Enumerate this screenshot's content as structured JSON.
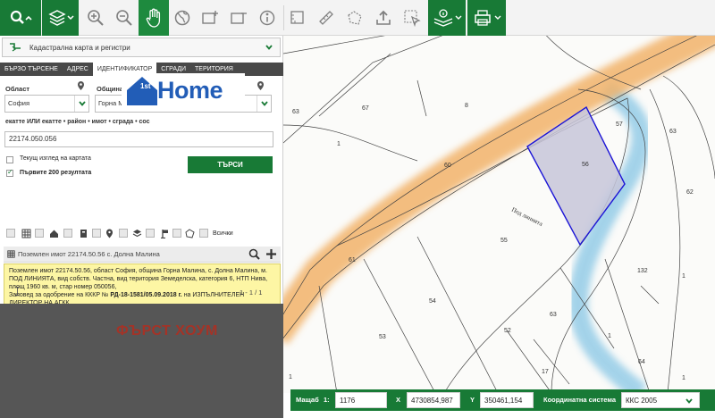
{
  "toolbar": {
    "tools": [
      {
        "icon": "search-icon"
      },
      {
        "icon": "layers-icon"
      },
      {
        "icon": "zoom-in-icon"
      },
      {
        "icon": "zoom-out-icon"
      },
      {
        "icon": "hand-pan-icon"
      },
      {
        "icon": "globe-icon"
      },
      {
        "icon": "add-region-icon"
      },
      {
        "icon": "remove-region-icon"
      },
      {
        "icon": "info-icon"
      },
      {
        "icon": "measure-area-icon"
      },
      {
        "icon": "measure-ruler-icon"
      },
      {
        "icon": "polygon-icon"
      },
      {
        "icon": "upload-icon"
      },
      {
        "icon": "select-region-icon"
      },
      {
        "icon": "layers-settings-icon"
      },
      {
        "icon": "print-icon"
      }
    ]
  },
  "panel": {
    "layer_select": "Кадастрална карта и регистри",
    "tabs": [
      "БЪРЗО ТЪРСЕНЕ",
      "АДРЕС",
      "ИДЕНТИФИКАТОР",
      "СГРАДИ",
      "ТЕРИТОРИЯ"
    ],
    "active_tab": 2,
    "oblast_label": "Област",
    "oblast_value": "София",
    "obshtina_label": "Община",
    "obshtina_value": "Горна Малина",
    "query_label": "екатте ИЛИ екатте • район • имот • сграда • сос",
    "query_value": "22174.050.056",
    "chk_current_view": "Текущ изглед на картата",
    "chk_first_200": "Първите 200 резултата",
    "search_button": "ТЪРСИ",
    "all_label": "Всички",
    "result_title": "Поземлен имот 22174.50.56 с. Долна Малина",
    "info_text": "Поземлен имот 22174.50.56, област София, община Горна Малина, с. Долна Малина, м. ПОД ЛИНИЯТА, вид собств. Частна, вид територия Земеделска, категория 6, НТП Нива, площ 1960 кв. м, стар номер 050056,",
    "info_text2_a": "Заповед за одобрение на КККР №",
    "info_text2_b": "РД-18-1581/05.09.2018 г.",
    "info_text2_c": "на ИЗПЪЛНИТЕЛЕН ДИРЕКТОР НА АГКК",
    "pager": "1 - 1 / 1",
    "watermark": "ФЪРСТ ХОУМ",
    "logo_text": "Home",
    "logo_prefix": "1st"
  },
  "map": {
    "street_label": "Под линията",
    "plot_numbers": [
      "63",
      "67",
      "8",
      "1",
      "57",
      "63",
      "56",
      "60",
      "62",
      "55",
      "61",
      "54",
      "53",
      "52",
      "63",
      "132",
      "1",
      "64",
      "17",
      "1",
      "1",
      "1"
    ],
    "highlight_color": "#1b14d6"
  },
  "status": {
    "scale_label": "Мащаб",
    "scale_prefix": "1:",
    "scale_value": "1176",
    "x_label": "X",
    "x_value": "4730854,987",
    "y_label": "Y",
    "y_value": "350461,154",
    "crs_label": "Координатна система",
    "crs_value": "ККС 2005"
  }
}
